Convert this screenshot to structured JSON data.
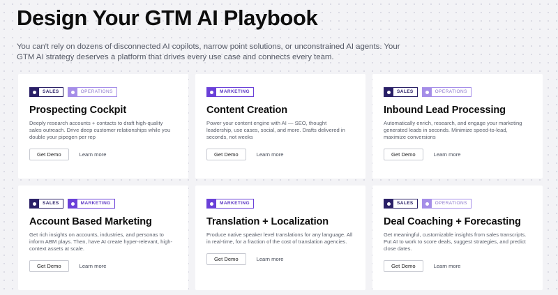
{
  "header": {
    "title": "Design Your GTM AI Playbook",
    "subtitle": "You can't rely on dozens of disconnected AI copilots, narrow point solutions, or unconstrained AI agents. Your GTM AI strategy deserves a platform that drives every use case and connects every team."
  },
  "colors": {
    "sales": "#2a2067",
    "operations": "#a58ee8",
    "marketing": "#6a40d8"
  },
  "cards": [
    {
      "tags": [
        "SALES",
        "OPERATIONS"
      ],
      "title": "Prospecting Cockpit",
      "description": "Deeply research accounts + contacts to draft high-quality sales outreach. Drive deep customer relationships while you double your pipegen per rep",
      "primary_cta": "Get Demo",
      "secondary_cta": "Learn more"
    },
    {
      "tags": [
        "MARKETING"
      ],
      "title": "Content Creation",
      "description": "Power your content engine with AI — SEO, thought leadership, use cases, social, and more. Drafts delivered in seconds, not weeks",
      "primary_cta": "Get Demo",
      "secondary_cta": "Learn more"
    },
    {
      "tags": [
        "SALES",
        "OPERATIONS"
      ],
      "title": "Inbound Lead Processing",
      "description": "Automatically enrich, research, and engage your marketing generated leads in seconds. Minimize speed-to-lead, maximize conversions",
      "primary_cta": "Get Demo",
      "secondary_cta": "Learn more"
    },
    {
      "tags": [
        "SALES",
        "MARKETING"
      ],
      "title": "Account Based Marketing",
      "description": "Get rich insights on accounts, industries, and personas to inform ABM plays. Then, have AI create hyper-relevant, high-context assets at scale.",
      "primary_cta": "Get Demo",
      "secondary_cta": "Learn more"
    },
    {
      "tags": [
        "MARKETING"
      ],
      "title": "Translation + Localization",
      "description": "Produce native speaker level translations for any language. All in real-time, for a fraction of the cost of translation agencies.",
      "primary_cta": "Get Demo",
      "secondary_cta": "Learn more"
    },
    {
      "tags": [
        "SALES",
        "OPERATIONS"
      ],
      "title": "Deal Coaching + Forecasting",
      "description": "Get meaningful, customizable insights from sales transcripts. Put AI to work to score deals, suggest strategies, and predict close dates.",
      "primary_cta": "Get Demo",
      "secondary_cta": "Learn more"
    }
  ]
}
